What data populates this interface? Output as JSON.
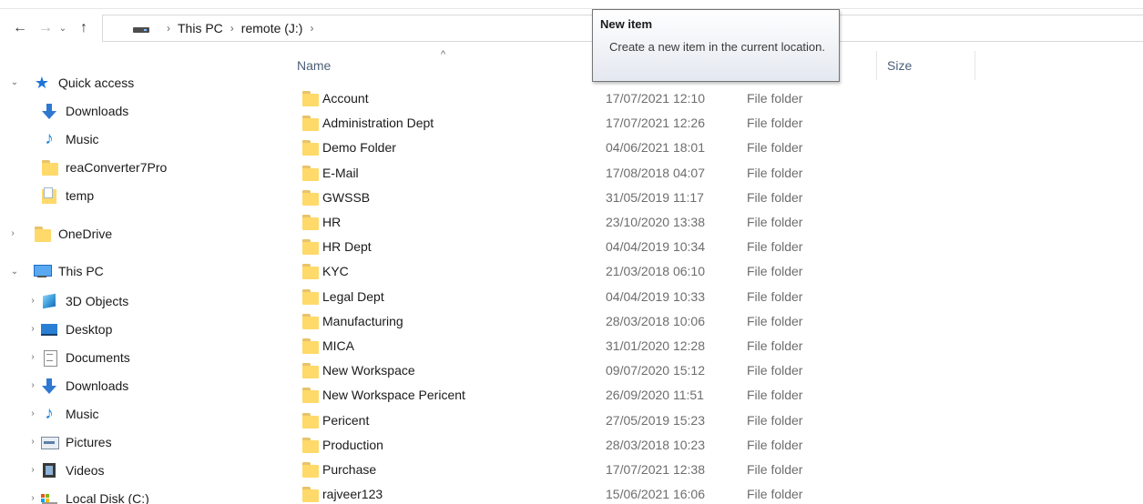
{
  "nav_buttons": {
    "back": "←",
    "forward": "→",
    "recent": "⌄",
    "up": "↑"
  },
  "address": {
    "crumbs": [
      "This PC",
      "remote (J:)"
    ]
  },
  "tooltip": {
    "title": "New item",
    "body": "Create a new item in the current location."
  },
  "sidebar": {
    "quick_access": "Quick access",
    "quick_items": [
      "Downloads",
      "Music",
      "reaConverter7Pro",
      "temp"
    ],
    "onedrive": "OneDrive",
    "this_pc": "This PC",
    "pc_items": [
      "3D Objects",
      "Desktop",
      "Documents",
      "Downloads",
      "Music",
      "Pictures",
      "Videos",
      "Local Disk (C:)"
    ]
  },
  "columns": {
    "name": "Name",
    "size": "Size"
  },
  "files": [
    {
      "name": "Account",
      "date": "17/07/2021 12:10",
      "type": "File folder"
    },
    {
      "name": "Administration Dept",
      "date": "17/07/2021 12:26",
      "type": "File folder"
    },
    {
      "name": "Demo Folder",
      "date": "04/06/2021 18:01",
      "type": "File folder"
    },
    {
      "name": "E-Mail",
      "date": "17/08/2018 04:07",
      "type": "File folder"
    },
    {
      "name": "GWSSB",
      "date": "31/05/2019 11:17",
      "type": "File folder"
    },
    {
      "name": "HR",
      "date": "23/10/2020 13:38",
      "type": "File folder"
    },
    {
      "name": "HR Dept",
      "date": "04/04/2019 10:34",
      "type": "File folder"
    },
    {
      "name": "KYC",
      "date": "21/03/2018 06:10",
      "type": "File folder"
    },
    {
      "name": "Legal Dept",
      "date": "04/04/2019 10:33",
      "type": "File folder"
    },
    {
      "name": "Manufacturing",
      "date": "28/03/2018 10:06",
      "type": "File folder"
    },
    {
      "name": "MICA",
      "date": "31/01/2020 12:28",
      "type": "File folder"
    },
    {
      "name": "New Workspace",
      "date": "09/07/2020 15:12",
      "type": "File folder"
    },
    {
      "name": "New Workspace Pericent",
      "date": "26/09/2020 11:51",
      "type": "File folder"
    },
    {
      "name": "Pericent",
      "date": "27/05/2019 15:23",
      "type": "File folder"
    },
    {
      "name": "Production",
      "date": "28/03/2018 10:23",
      "type": "File folder"
    },
    {
      "name": "Purchase",
      "date": "17/07/2021 12:38",
      "type": "File folder"
    },
    {
      "name": "rajveer123",
      "date": "15/06/2021 16:06",
      "type": "File folder"
    }
  ]
}
